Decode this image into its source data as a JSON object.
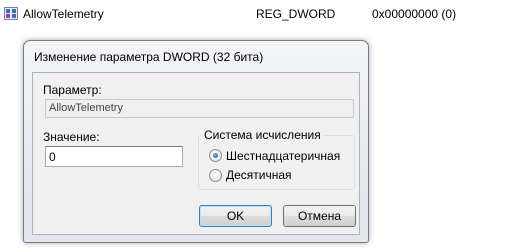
{
  "registry_row": {
    "name": "AllowTelemetry",
    "type": "REG_DWORD",
    "data": "0x00000000 (0)",
    "icon": "dword-value-icon"
  },
  "dialog": {
    "title": "Изменение параметра DWORD (32 бита)",
    "param_label": "Параметр:",
    "param_value": "AllowTelemetry",
    "value_label": "Значение:",
    "value_input": "0",
    "base_group": {
      "title": "Система исчисления",
      "options": [
        {
          "label": "Шестнадцатеричная",
          "selected": true
        },
        {
          "label": "Десятичная",
          "selected": false
        }
      ]
    },
    "ok_label": "OK",
    "cancel_label": "Отмена"
  },
  "colors": {
    "dialog_border": "#6f7e91",
    "ok_border": "#3c7fb1",
    "radio_dot": "#1c5fb0",
    "window_bg": "#f0f0f0"
  }
}
